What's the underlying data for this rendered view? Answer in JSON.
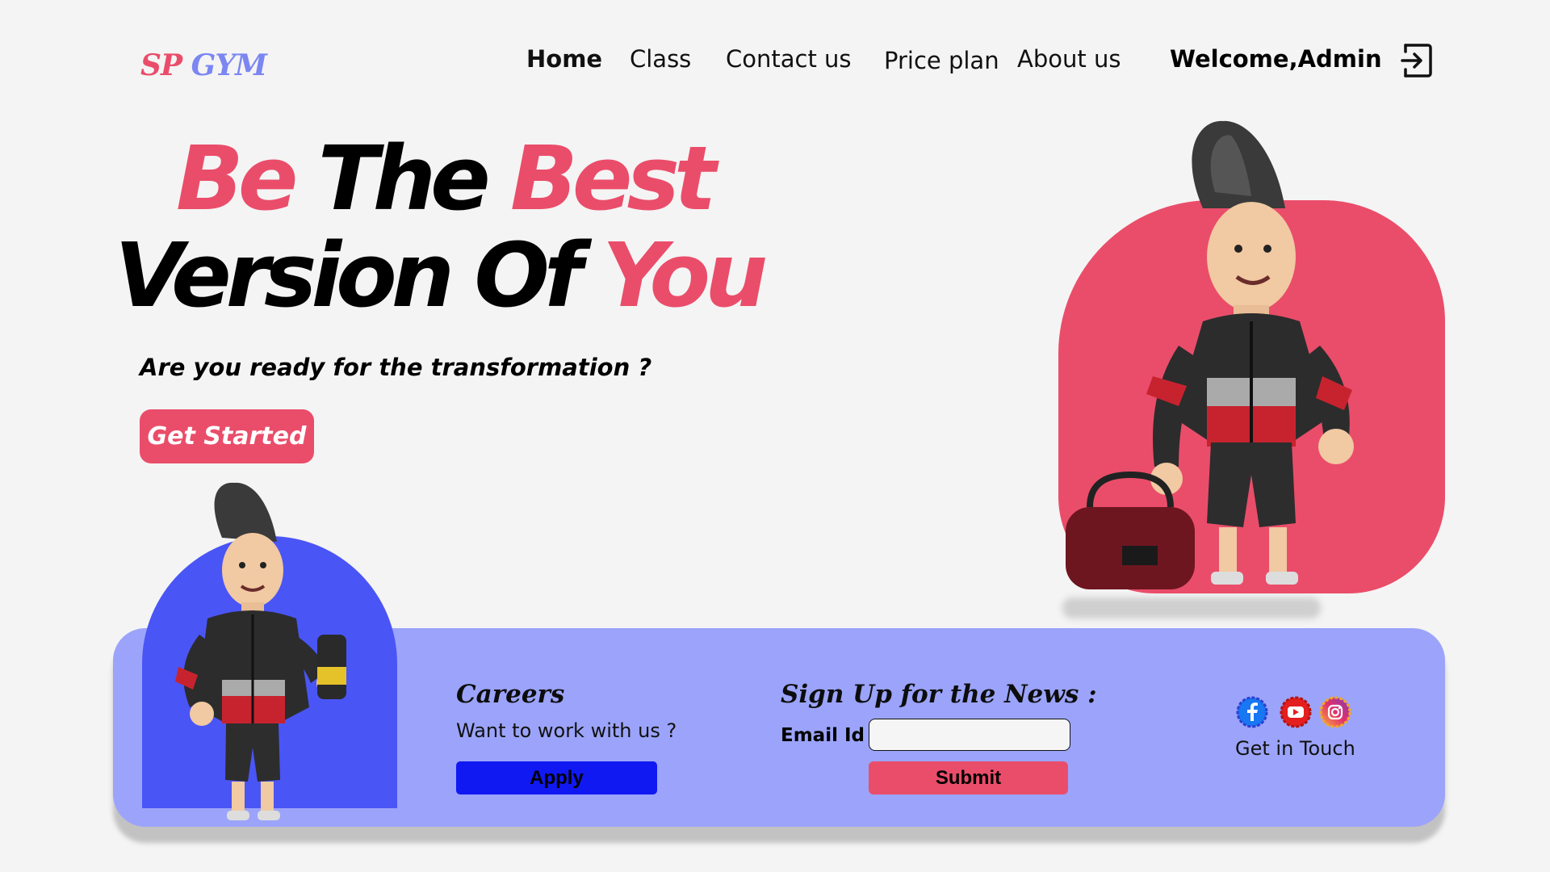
{
  "brand": {
    "part1": "SP",
    "part2": "GYM",
    "pink": "#ea4d6a",
    "periwinkle": "#7b86f2"
  },
  "nav": {
    "home": "Home",
    "class": "Class",
    "contact": "Contact us",
    "price": "Price plan",
    "about": "About us"
  },
  "user": {
    "welcome": "Welcome,Admin",
    "logout_icon": "logout-icon"
  },
  "hero": {
    "line1_a": "Be",
    "line1_b": "The",
    "line1_c": "Best",
    "line2_a": "Version Of",
    "line2_b": "You",
    "tagline": "Are you ready for the transformation ?",
    "cta": "Get Started"
  },
  "careers": {
    "title": "Careers",
    "text": "Want to work with us ?",
    "button": "Apply"
  },
  "newsletter": {
    "title": "Sign Up for the News :",
    "email_label": "Email Id :",
    "email_value": "",
    "button": "Submit"
  },
  "contact": {
    "icons": [
      "facebook-icon",
      "youtube-icon",
      "instagram-icon"
    ],
    "text": "Get in Touch"
  },
  "colors": {
    "accent": "#ea4d6a",
    "card": "#9ba4fa",
    "apply": "#1119f3",
    "arch": "#4a55f6"
  },
  "images": {
    "hero_character_pink": "3D gym mascot holding bag",
    "hero_character_blue": "3D gym mascot holding shaker"
  }
}
